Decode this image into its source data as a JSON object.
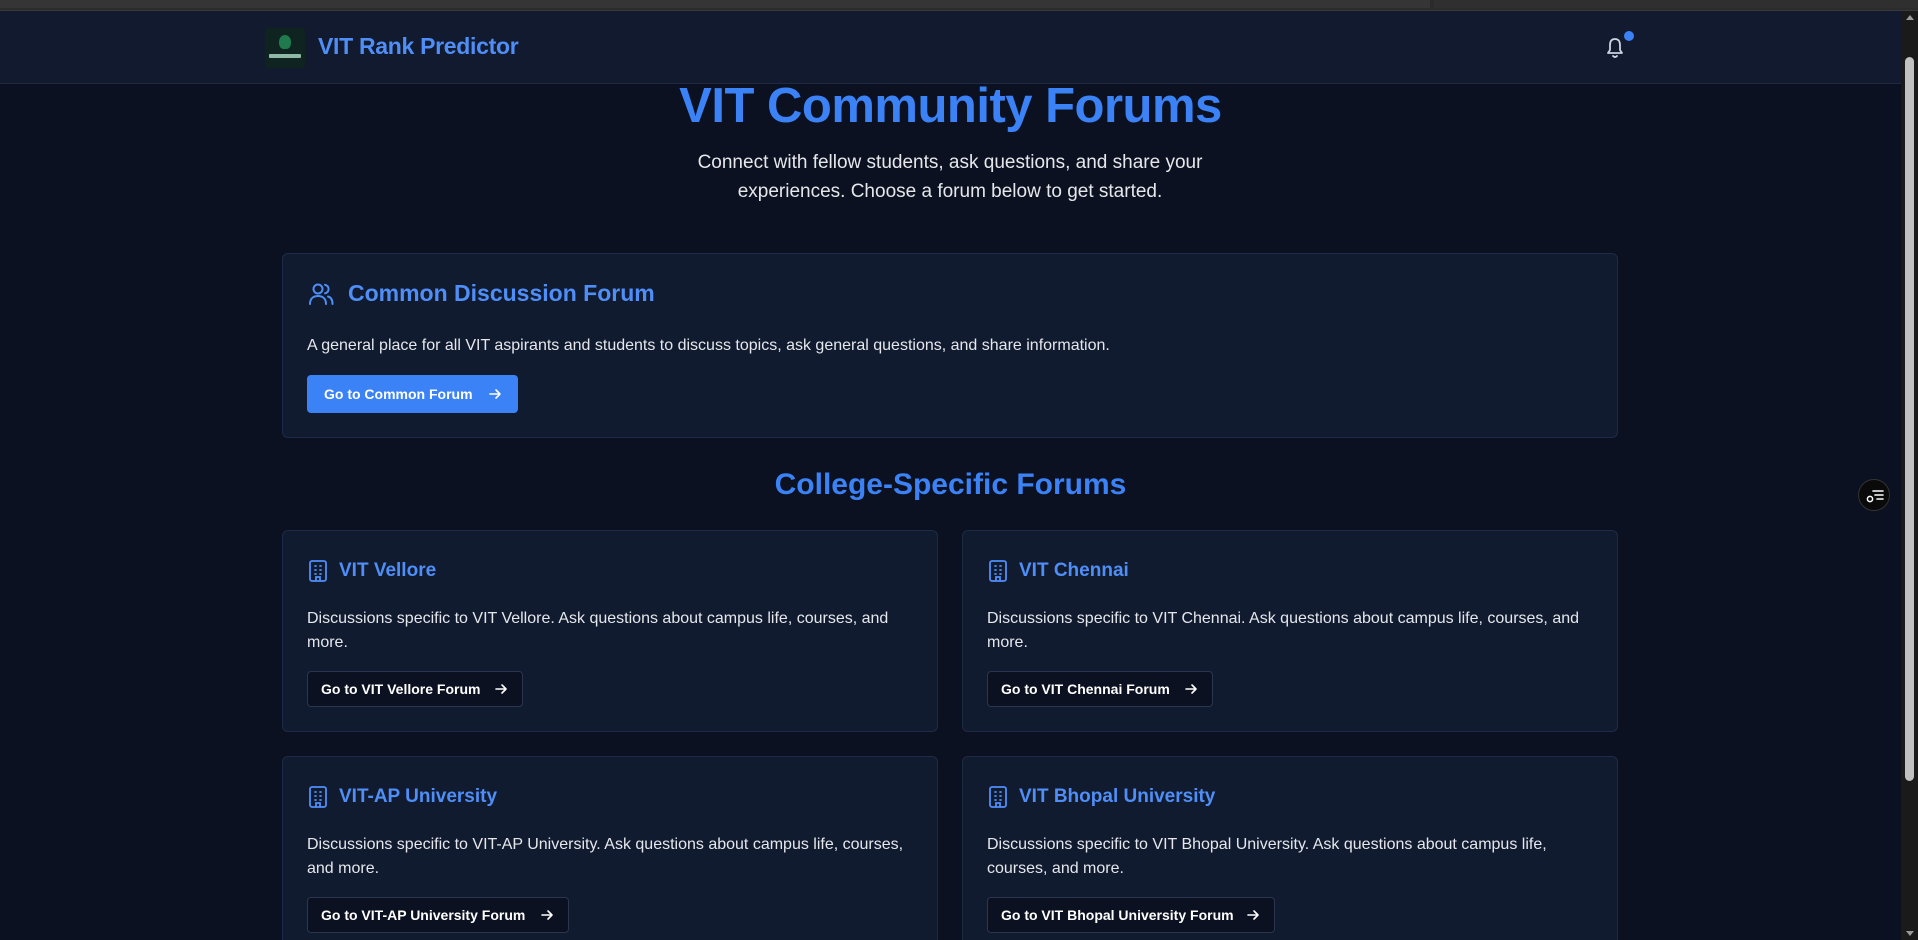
{
  "header": {
    "brand": "VIT Rank Predictor",
    "logo_icon": "rank-predictor-logo",
    "notification_icon": "bell-icon",
    "has_unread": true
  },
  "hero": {
    "title": "VIT Community Forums",
    "subtitle": "Connect with fellow students, ask questions, and share your experiences. Choose a forum below to get started."
  },
  "common_forum": {
    "icon": "users-icon",
    "title": "Common Discussion Forum",
    "description": "A general place for all VIT aspirants and students to discuss topics, ask general questions, and share information.",
    "button_label": "Go to Common Forum"
  },
  "college_section": {
    "title": "College-Specific Forums",
    "forums": [
      {
        "icon": "building-icon",
        "title": "VIT Vellore",
        "description": "Discussions specific to VIT Vellore. Ask questions about campus life, courses, and more.",
        "button_label": "Go to VIT Vellore Forum"
      },
      {
        "icon": "building-icon",
        "title": "VIT Chennai",
        "description": "Discussions specific to VIT Chennai. Ask questions about campus life, courses, and more.",
        "button_label": "Go to VIT Chennai Forum"
      },
      {
        "icon": "building-icon",
        "title": "VIT-AP University",
        "description": "Discussions specific to VIT-AP University. Ask questions about campus life, courses, and more.",
        "button_label": "Go to VIT-AP University Forum"
      },
      {
        "icon": "building-icon",
        "title": "VIT Bhopal University",
        "description": "Discussions specific to VIT Bhopal University. Ask questions about campus life, courses, and more.",
        "button_label": "Go to VIT Bhopal University Forum"
      }
    ]
  },
  "floating_widget_icon": "list-settings-icon",
  "colors": {
    "accent": "#3b82f6",
    "background": "#0b1120",
    "card": "#111b30"
  }
}
